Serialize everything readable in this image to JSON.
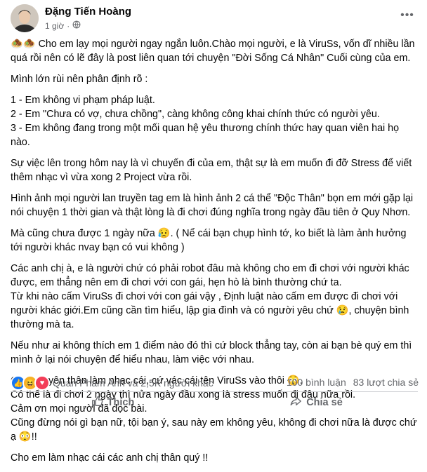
{
  "post": {
    "author": "Đặng Tiến Hoàng",
    "time": "1 giờ",
    "paragraphs": [
      "🧆🧆 Cho em lạy mọi người ngay ngắn luôn.Chào mọi người, e là ViruSs, vốn dĩ nhiều lần quá rồi nên có lẽ đây là post liên quan tới chuyện \"Đời Sống Cá Nhân\" Cuối cùng của em.",
      "Mình lớn rùi nên phân định rõ :",
      "1 - Em không vi phạm pháp luật.\n2 - Em \"Chưa có vợ, chưa chồng\", càng không công khai chính thức có người yêu.\n3 - Em không đang trong một mối quan hệ yêu thương chính thức hay quan viên hai họ nào.",
      "Sự việc lên trong hôm nay là vì chuyến đi của em, thật sự là em muốn đi đỡ Stress để viết thêm nhạc vì vừa xong 2 Project vừa rồi.",
      "Hình ảnh mọi người lan truyền tag em là hình ảnh 2 cá thể \"Độc Thân\" bọn em mới gặp lại nói chuyện 1 thời gian và thật lòng là đi chơi đúng nghĩa trong ngày đầu tiên ở Quy Nhơn.",
      "Mà cũng chưa được 1 ngày nữa 😥. ( Nể cái bạn chụp hình tớ, ko biết là làm ảnh hưởng tới người khác nvay bạn có vui không )",
      "Các anh chị à, e là người chứ có phải robot đâu mà không cho em đi chơi với người khác được, em thẳng nên em đi chơi với con gái, hẹn hò là bình thường chứ ta.\nTừ khi nào cấm ViruSs đi chơi với con gái vậy , Định luật nào cấm em được đi chơi với người khác giới.Em cũng cần tìm hiểu, lập gia đình và có người yêu chứ 😢, chuyện bình thường mà ta.",
      "Nếu như ai không thích em 1 điểm nào đó thì cứ block thẳng tay, còn ai bạn bè quý em thì mình ở lại nói chuyện để hiểu nhau, làm việc với nhau.",
      "Cho em yên thân làm nhạc cái, cứ vác cái tên ViruSs vào thôi 😳.\nCó thể là đi chơi 2 ngày thì nửa ngày đầu xong là stress muốn đi đâu nữa rồi.\nCảm ơn mọi người đã đọc bài.\nCũng đừng nói gì bạn nữ, tội bạn ý, sau này em không yêu, không đi chơi nữa là được chứ ạ 😳!!",
      "Cho em làm nhạc cái các anh chị thân quý !!"
    ],
    "reactions_text": "Quan Pham Anh và 2,5K người khác",
    "comments": "100 bình luận",
    "shares": "83 lượt chia sẻ",
    "like_label": "Thích",
    "share_label": "Chia sẻ"
  }
}
